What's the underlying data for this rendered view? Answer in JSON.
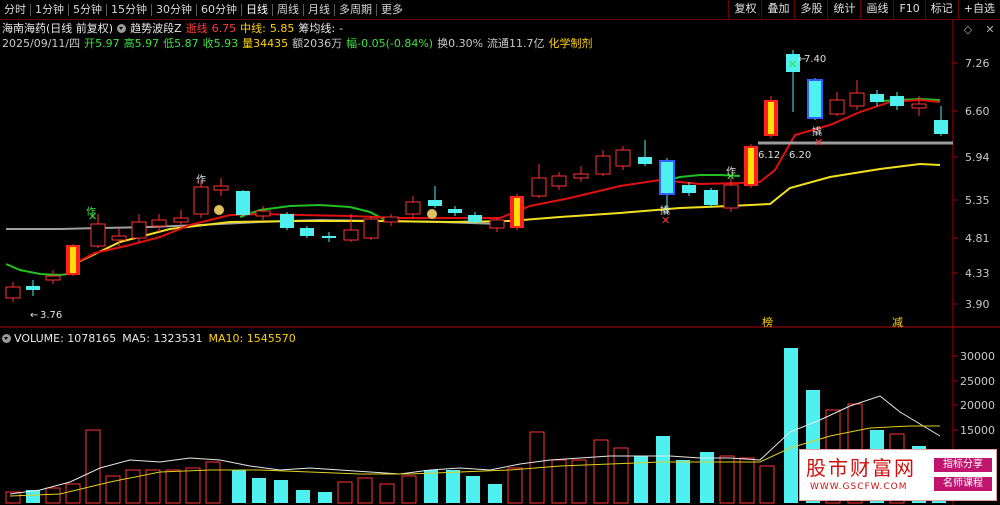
{
  "toolbar": {
    "periods": [
      "分时",
      "1分钟",
      "5分钟",
      "15分钟",
      "30分钟",
      "60分钟",
      "日线",
      "周线",
      "月线",
      "多周期",
      "更多"
    ],
    "active_period": "日线",
    "right_buttons": [
      "复权",
      "叠加",
      "多股",
      "统计",
      "画线",
      "F10",
      "标记",
      "+自选"
    ]
  },
  "stock": {
    "name": "海南海药(日线 前复权)",
    "indicator": "趋势波段Z",
    "stop_label": "逝线",
    "stop_value": "6.75",
    "mid_label": "中线:",
    "mid_value": "5.85",
    "chip_label": "筹均线:",
    "chip_value": "-"
  },
  "quote": {
    "date": "2025/09/11/四",
    "open": "开5.97",
    "high": "高5.97",
    "low": "低5.87",
    "close": "收5.93",
    "volume": "量34435",
    "amount": "额2036万",
    "change": "幅-0.05(-0.84%)",
    "turnover": "换0.30%",
    "float_cap": "流通11.7亿",
    "industry": "化学制剂"
  },
  "price_axis": {
    "labels": [
      "7.26",
      "6.60",
      "5.94",
      "5.35",
      "4.81",
      "4.33",
      "3.90"
    ]
  },
  "annotations": {
    "low_marker": "3.76",
    "high_marker": "7.40",
    "level_a": "6.12",
    "level_b": "6.20",
    "buy_tag": "作",
    "sell_tag": "撬",
    "bottom_tag_1": "榜",
    "bottom_tag_2": "减"
  },
  "volume": {
    "label": "VOLUME:",
    "value": "1078165",
    "ma5_label": "MA5:",
    "ma5_value": "1323531",
    "ma10_label": "MA10:",
    "ma10_value": "1545570",
    "axis_labels": [
      "30000",
      "25000",
      "20000",
      "15000",
      "10000"
    ]
  },
  "colors": {
    "up": "#ff3333",
    "down": "#4ef0f0",
    "ma_red": "#e01010",
    "ma_yellow": "#f0e020",
    "ma_green": "#20c020",
    "ma_gray": "#9a9a9a",
    "axis": "#c00000"
  },
  "watermark": {
    "title": "股市财富网",
    "url": "WWW.GSCFW.COM",
    "tag1": "指标分享",
    "tag2": "名师课程"
  }
}
